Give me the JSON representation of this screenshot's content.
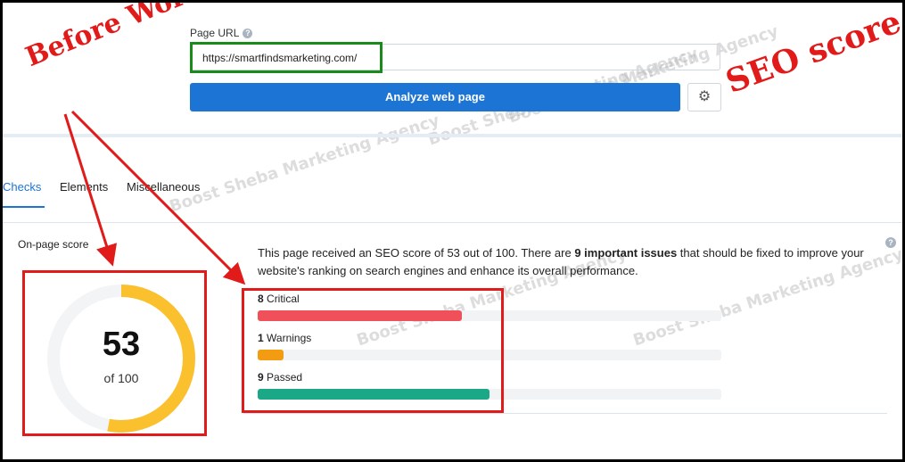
{
  "form": {
    "url_label": "Page URL",
    "url_value": "https://smartfindsmarketing.com/",
    "analyze_label": "Analyze web page",
    "settings_icon": "gear-icon"
  },
  "tabs": [
    {
      "label": "Checks",
      "active": true
    },
    {
      "label": "Elements",
      "active": false
    },
    {
      "label": "Miscellaneous",
      "active": false
    }
  ],
  "score": {
    "label": "On-page score",
    "value": "53",
    "of": "of 100",
    "fraction": 0.53
  },
  "summary": {
    "part1": "This page received an SEO score of 53 out of 100. There are ",
    "bold": "9 important issues",
    "part2": " that should be fixed to improve your website's ranking on search engines and enhance its overall performance."
  },
  "stats": [
    {
      "count": "8",
      "label": " Critical",
      "fraction": 0.44,
      "color": "#f0505a"
    },
    {
      "count": "1",
      "label": " Warnings",
      "fraction": 0.055,
      "color": "#f39c12"
    },
    {
      "count": "9",
      "label": " Passed",
      "fraction": 0.5,
      "color": "#1aa886"
    }
  ],
  "annotations": {
    "before": "Before Work",
    "seo": "SEO score",
    "color": "#e11a1a"
  },
  "watermark": "Boost Sheba Marketing Agency",
  "colors": {
    "accent": "#1c74d4",
    "gauge": "#fbc02d",
    "gauge_track": "#f3f4f6"
  }
}
